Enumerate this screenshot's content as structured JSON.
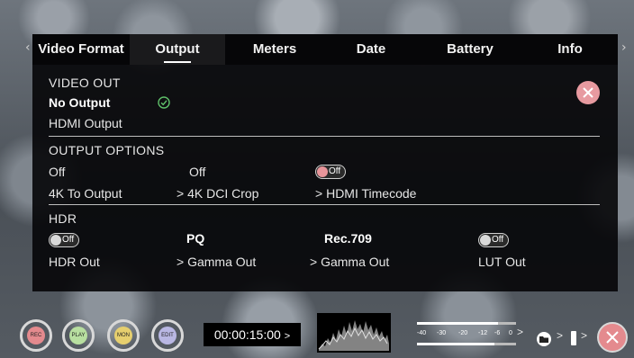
{
  "tabs": [
    {
      "label": "Video Format",
      "active": false
    },
    {
      "label": "Output",
      "active": true
    },
    {
      "label": "Meters",
      "active": false
    },
    {
      "label": "Date",
      "active": false
    },
    {
      "label": "Battery",
      "active": false
    },
    {
      "label": "Info",
      "active": false
    }
  ],
  "nav": {
    "prev_icon": "chevron-left-icon",
    "next_icon": "chevron-right-icon"
  },
  "video_out": {
    "heading": "VIDEO OUT",
    "options": [
      {
        "label": "No Output",
        "selected": true
      },
      {
        "label": "HDMI Output",
        "selected": false
      }
    ],
    "check_icon": "check-circle-icon"
  },
  "output_options": {
    "heading": "OUTPUT OPTIONS",
    "items": [
      {
        "value": "Off",
        "label": "4K To Output",
        "arrow": ""
      },
      {
        "value": "Off",
        "label": "4K DCI Crop",
        "arrow": ">"
      },
      {
        "toggle": "Off",
        "label": "HDMI Timecode",
        "arrow": ">"
      }
    ]
  },
  "hdr": {
    "heading": "HDR",
    "items": [
      {
        "toggle": "Off",
        "label": "HDR Out",
        "arrow": ""
      },
      {
        "value": "PQ",
        "label": "Gamma Out",
        "arrow": ">"
      },
      {
        "value": "Rec.709",
        "label": "Gamma Out",
        "arrow": ">"
      },
      {
        "toggle": "Off",
        "label": "LUT Out",
        "arrow": ""
      }
    ]
  },
  "bottom_bar": {
    "buttons": [
      {
        "label": "REC",
        "color": "#e48a8e"
      },
      {
        "label": "PLAY",
        "color": "#b8dfa0"
      },
      {
        "label": "MON",
        "color": "#e6cf6e"
      },
      {
        "label": "EDIT",
        "color": "#b9b7e3"
      }
    ],
    "timecode": "00:00:15:00",
    "timecode_arrow": ">",
    "meter_ticks": [
      "-40",
      "-30",
      "-20",
      "-12",
      "-6",
      "0"
    ],
    "meter_arrow": ">",
    "folder_arrow": ">",
    "battery_arrow": ">",
    "levels": [
      0.82,
      0.78
    ]
  },
  "colors": {
    "accent_pink": "#e79aa0",
    "check_green": "#5fc06a"
  }
}
